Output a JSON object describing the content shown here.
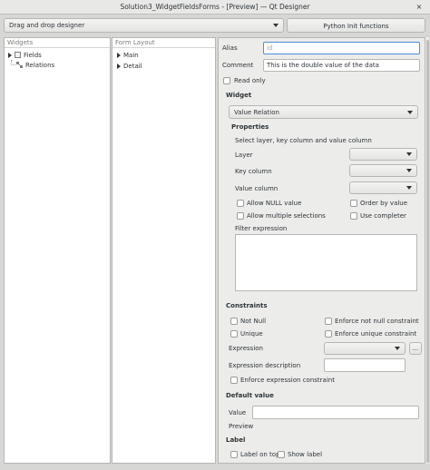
{
  "window": {
    "title": "Solution3_WidgetFieldsForms - [Preview] — Qt Designer",
    "close_glyph": "×"
  },
  "toolbar": {
    "mode_combo": "Drag and drop designer",
    "python_button": "Python Init functions"
  },
  "widgets_panel": {
    "header": "Widgets",
    "items": [
      {
        "label": "Fields"
      },
      {
        "label": "Relations"
      }
    ]
  },
  "form_layout_panel": {
    "header": "Form Layout",
    "items": [
      {
        "label": "Main"
      },
      {
        "label": "Detail"
      }
    ]
  },
  "form": {
    "alias_label": "Alias",
    "alias_placeholder": "id",
    "comment_label": "Comment",
    "comment_value": "This is the double value of the data",
    "read_only_label": "Read only",
    "widget_section": "Widget",
    "widget_type": "Value Relation",
    "properties_section": "Properties",
    "select_hint": "Select layer, key column and value column",
    "layer_label": "Layer",
    "key_column_label": "Key column",
    "value_column_label": "Value column",
    "allow_null_label": "Allow NULL value",
    "order_by_value_label": "Order by value",
    "allow_multiple_label": "Allow multiple selections",
    "use_completer_label": "Use completer",
    "filter_expression_label": "Filter expression",
    "constraints_section": "Constraints",
    "not_null_label": "Not Null",
    "enforce_not_null_label": "Enforce not null constraint",
    "unique_label": "Unique",
    "enforce_unique_label": "Enforce unique constraint",
    "expression_label": "Expression",
    "expression_button": "...",
    "expression_description_label": "Expression description",
    "enforce_expression_label": "Enforce expression constraint",
    "default_value_section": "Default value",
    "value_label": "Value",
    "preview_label": "Preview",
    "label_section": "Label",
    "label_on_top_label": "Label on top",
    "show_label_label": "Show label"
  }
}
